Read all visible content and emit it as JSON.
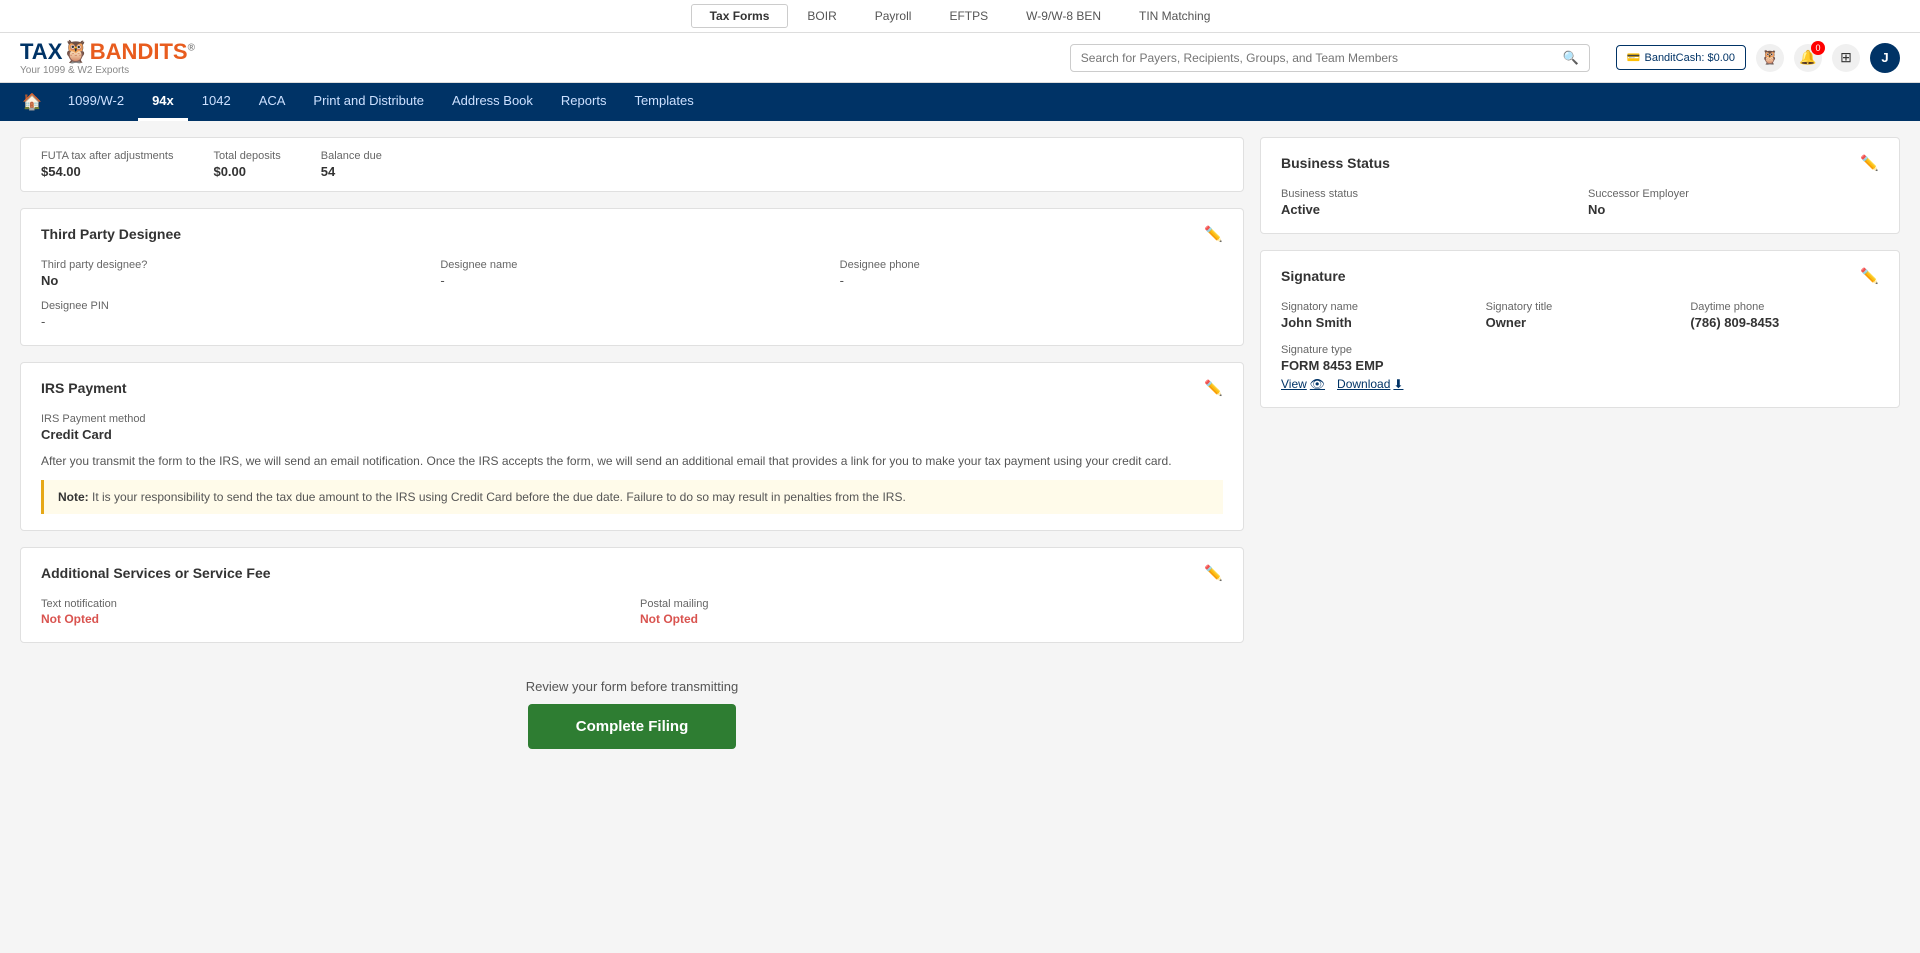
{
  "topnav": {
    "items": [
      {
        "label": "Tax Forms",
        "active": true
      },
      {
        "label": "BOIR",
        "active": false
      },
      {
        "label": "Payroll",
        "active": false
      },
      {
        "label": "EFTPS",
        "active": false
      },
      {
        "label": "W-9/W-8 BEN",
        "active": false
      },
      {
        "label": "TIN Matching",
        "active": false
      }
    ]
  },
  "header": {
    "logo": "TAX",
    "logo_accent": "BANDITS",
    "logo_tm": "®",
    "logo_sub": "Your 1099 & W2 Exports",
    "search_placeholder": "Search for Payers, Recipients, Groups, and Team Members",
    "bandit_cash": "BanditCash: $0.00",
    "notification_count": "0",
    "avatar_initial": "J"
  },
  "secnav": {
    "items": [
      {
        "label": "1099/W-2",
        "active": false
      },
      {
        "label": "94x",
        "active": true
      },
      {
        "label": "1042",
        "active": false
      },
      {
        "label": "ACA",
        "active": false
      },
      {
        "label": "Print and Distribute",
        "active": false
      },
      {
        "label": "Address Book",
        "active": false
      },
      {
        "label": "Reports",
        "active": false
      },
      {
        "label": "Templates",
        "active": false
      }
    ]
  },
  "summary": {
    "futa_label": "FUTA tax after adjustments",
    "futa_value": "$54.00",
    "deposits_label": "Total deposits",
    "deposits_value": "$0.00",
    "balance_label": "Balance due",
    "balance_value": "54"
  },
  "third_party": {
    "title": "Third Party Designee",
    "designee_q_label": "Third party designee?",
    "designee_q_value": "No",
    "designee_name_label": "Designee name",
    "designee_name_value": "-",
    "designee_phone_label": "Designee phone",
    "designee_phone_value": "-",
    "designee_pin_label": "Designee PIN",
    "designee_pin_value": "-"
  },
  "irs_payment": {
    "title": "IRS Payment",
    "method_label": "IRS Payment method",
    "method_value": "Credit Card",
    "description": "After you transmit the form to the IRS, we will send an email notification. Once the IRS accepts the form, we will send an additional email that provides a link for you to make your tax payment using your credit card.",
    "note_label": "Note:",
    "note_text": " It is your responsibility to send the tax due amount to the IRS using Credit Card before the due date. Failure to do so may result in penalties from the IRS."
  },
  "additional_services": {
    "title": "Additional Services or Service Fee",
    "text_notification_label": "Text notification",
    "text_notification_value": "Not Opted",
    "postal_mailing_label": "Postal mailing",
    "postal_mailing_value": "Not Opted"
  },
  "complete_filing": {
    "review_label": "Review your form before transmitting",
    "button_label": "Complete Filing"
  },
  "business_status": {
    "title": "Business Status",
    "status_label": "Business status",
    "status_value": "Active",
    "successor_label": "Successor Employer",
    "successor_value": "No"
  },
  "signature": {
    "title": "Signature",
    "name_label": "Signatory name",
    "name_value": "John Smith",
    "title_label": "Signatory title",
    "title_value": "Owner",
    "phone_label": "Daytime phone",
    "phone_value": "(786) 809-8453",
    "type_label": "Signature type",
    "type_value": "FORM 8453 EMP",
    "view_label": "View",
    "download_label": "Download"
  }
}
